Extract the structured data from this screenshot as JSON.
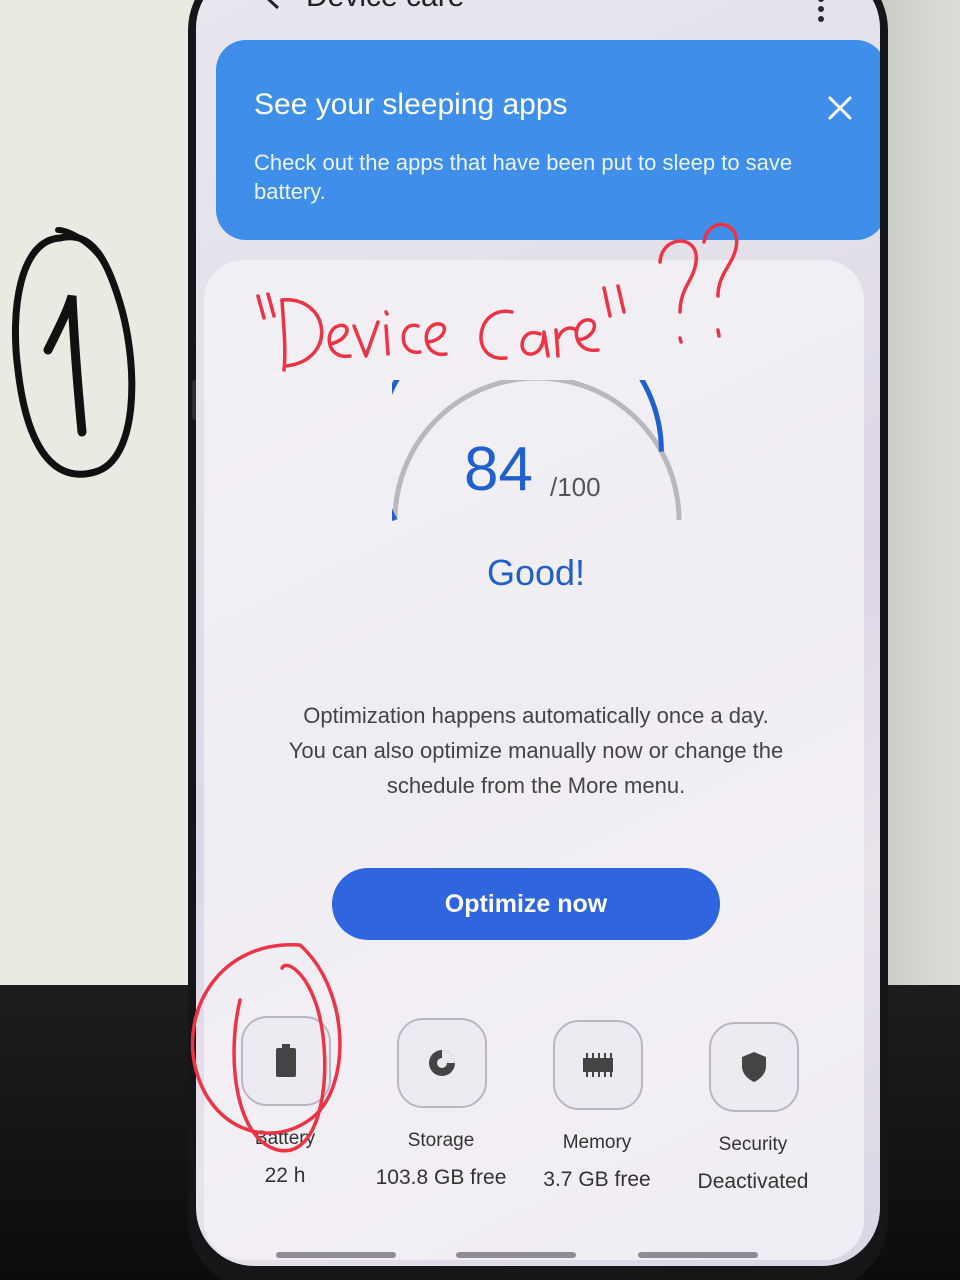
{
  "topbar": {
    "title": "Device care"
  },
  "banner": {
    "title": "See your sleeping apps",
    "body": "Check out the apps that have been put to sleep to save battery."
  },
  "score": {
    "value": "84",
    "max": "/100",
    "status": "Good!",
    "fraction": 0.84
  },
  "description": {
    "line1": "Optimization happens automatically once a day.",
    "line2": "You can also optimize manually now or change the",
    "line3": "schedule from the More menu."
  },
  "optimize_button": {
    "label": "Optimize now"
  },
  "items": [
    {
      "label": "Battery",
      "value": "22 h",
      "icon": "battery-icon"
    },
    {
      "label": "Storage",
      "value": "103.8 GB free",
      "icon": "pie-chart-icon"
    },
    {
      "label": "Memory",
      "value": "3.7 GB free",
      "icon": "memory-chip-icon"
    },
    {
      "label": "Security",
      "value": "Deactivated",
      "icon": "shield-icon"
    }
  ],
  "annotations": {
    "handwritten_title": "\"Device Care\" ??",
    "handwritten_number": "1"
  },
  "colors": {
    "accent": "#2f66e0",
    "banner": "#3f8fea",
    "score": "#1f5fcf",
    "annotation_red": "#ee3344"
  }
}
